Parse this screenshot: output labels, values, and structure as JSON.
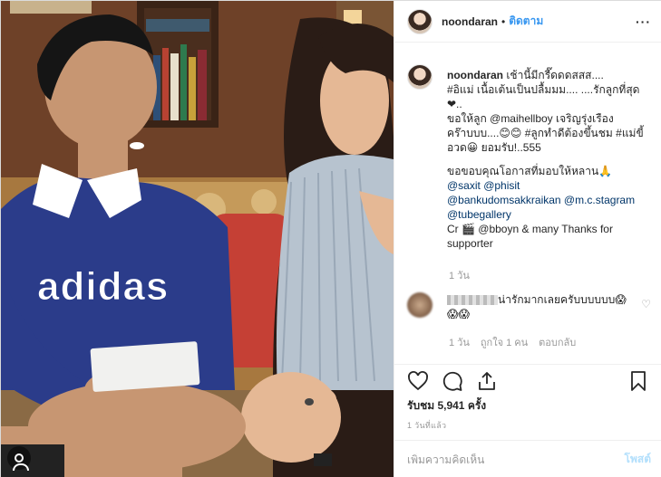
{
  "header": {
    "username": "noondaran",
    "separator": "•",
    "follow_label": "ติดตาม",
    "more_label": "···"
  },
  "caption": {
    "username": "noondaran",
    "lines": [
      " เช้านี้มีกรี๊ดดดสสส....",
      "#อิแม่ เนื้อเต้นเป็นปลื้มมม.... ....รักลูกที่สุด❤..",
      "ขอให้ลูก @maihellboy เจริญรุ่งเรืองคร๊าบบบ....😊😊 #ลูกทำดีต้องขึ้นชม #แม่ขี้อวด😀 ยอมรับ!..555",
      "",
      "ขอขอบคุณโอกาสที่มอบให้หลาน🙏",
      "@saxit @phisit",
      "@bankudomsakkraikan @m.c.stagram",
      "@tubegallery",
      "Cr 🎬 @bboyn & many Thanks for supporter"
    ],
    "time": "1 วัน"
  },
  "comment2": {
    "text": "น่ารักมากเลยครับบบบบบ😱😱😱",
    "time": "1 วัน",
    "likes": "ถูกใจ 1 คน",
    "reply": "ตอบกลับ"
  },
  "likes_label": "รับชม 5,941 ครั้ง",
  "ago_label": "1 วันที่แล้ว",
  "add_comment": {
    "placeholder": "เพิ่มความคิดเห็น",
    "post_label": "โพสต์"
  },
  "photo": {
    "shirt_brand": "adidas"
  },
  "colors": {
    "link": "#003569",
    "follow": "#3897f0",
    "muted": "#999999"
  }
}
